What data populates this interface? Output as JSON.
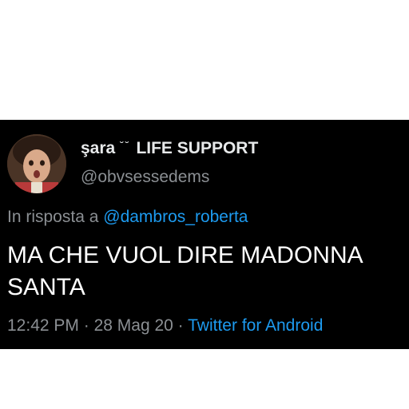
{
  "tweet": {
    "display_name": "şara",
    "display_name_deco": "˘ ˘",
    "display_name_suffix": "LIFE SUPPORT",
    "handle": "@obvsessedems",
    "reply_prefix": "In risposta a",
    "reply_to": "@dambros_roberta",
    "text": "MA CHE VUOL DIRE MADONNA SANTA",
    "time": "12:42 PM",
    "date": "28 Mag 20",
    "separator": "·",
    "source": "Twitter for Android"
  },
  "colors": {
    "background": "#000000",
    "page": "#ffffff",
    "text": "#ffffff",
    "muted": "#8b8f93",
    "link": "#1d9bf0"
  },
  "icons": {
    "avatar": "profile-photo"
  }
}
